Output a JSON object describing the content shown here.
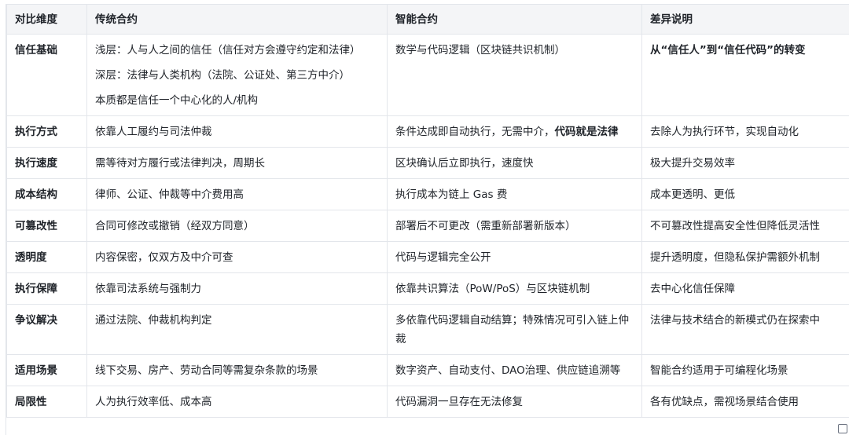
{
  "headers": [
    "对比维度",
    "传统合约",
    "智能合约",
    "差异说明"
  ],
  "rows": [
    {
      "dim": "信任基础",
      "traditional": [
        "浅层：人与人之间的信任（信任对方会遵守约定和法律）",
        "深层：法律与人类机构（法院、公证处、第三方中介）",
        "本质都是信任一个中心化的人/机构"
      ],
      "smart": "数学与代码逻辑（区块链共识机制）",
      "smart_bold": "",
      "diff": "从“信任人”到“信任代码”的转变",
      "diff_bold": true
    },
    {
      "dim": "执行方式",
      "traditional": [
        "依靠人工履约与司法仲裁"
      ],
      "smart": "条件达成即自动执行，无需中介，",
      "smart_bold": "代码就是法律",
      "diff": "去除人为执行环节，实现自动化",
      "diff_bold": false
    },
    {
      "dim": "执行速度",
      "traditional": [
        "需等待对方履行或法律判决，周期长"
      ],
      "smart": "区块确认后立即执行，速度快",
      "smart_bold": "",
      "diff": "极大提升交易效率",
      "diff_bold": false
    },
    {
      "dim": "成本结构",
      "traditional": [
        "律师、公证、仲裁等中介费用高"
      ],
      "smart": "执行成本为链上 Gas 费",
      "smart_bold": "",
      "diff": "成本更透明、更低",
      "diff_bold": false
    },
    {
      "dim": "可篡改性",
      "traditional": [
        "合同可修改或撤销（经双方同意）"
      ],
      "smart": "部署后不可更改（需重新部署新版本）",
      "smart_bold": "",
      "diff": "不可篡改性提高安全性但降低灵活性",
      "diff_bold": false
    },
    {
      "dim": "透明度",
      "traditional": [
        "内容保密，仅双方及中介可查"
      ],
      "smart": "代码与逻辑完全公开",
      "smart_bold": "",
      "diff": "提升透明度，但隐私保护需额外机制",
      "diff_bold": false
    },
    {
      "dim": "执行保障",
      "traditional": [
        "依靠司法系统与强制力"
      ],
      "smart": "依靠共识算法（PoW/PoS）与区块链机制",
      "smart_bold": "",
      "diff": "去中心化信任保障",
      "diff_bold": false
    },
    {
      "dim": "争议解决",
      "traditional": [
        "通过法院、仲裁机构判定"
      ],
      "smart": "多依靠代码逻辑自动结算；特殊情况可引入链上仲裁",
      "smart_bold": "",
      "diff": "法律与技术结合的新模式仍在探索中",
      "diff_bold": false
    },
    {
      "dim": "适用场景",
      "traditional": [
        "线下交易、房产、劳动合同等需复杂条款的场景"
      ],
      "smart": "数字资产、自动支付、DAO治理、供应链追溯等",
      "smart_bold": "",
      "diff": "智能合约适用于可编程化场景",
      "diff_bold": false
    },
    {
      "dim": "局限性",
      "traditional": [
        "人为执行效率低、成本高"
      ],
      "smart": "代码漏洞一旦存在无法修复",
      "smart_bold": "",
      "diff": "各有优缺点，需视场景结合使用",
      "diff_bold": false
    }
  ]
}
